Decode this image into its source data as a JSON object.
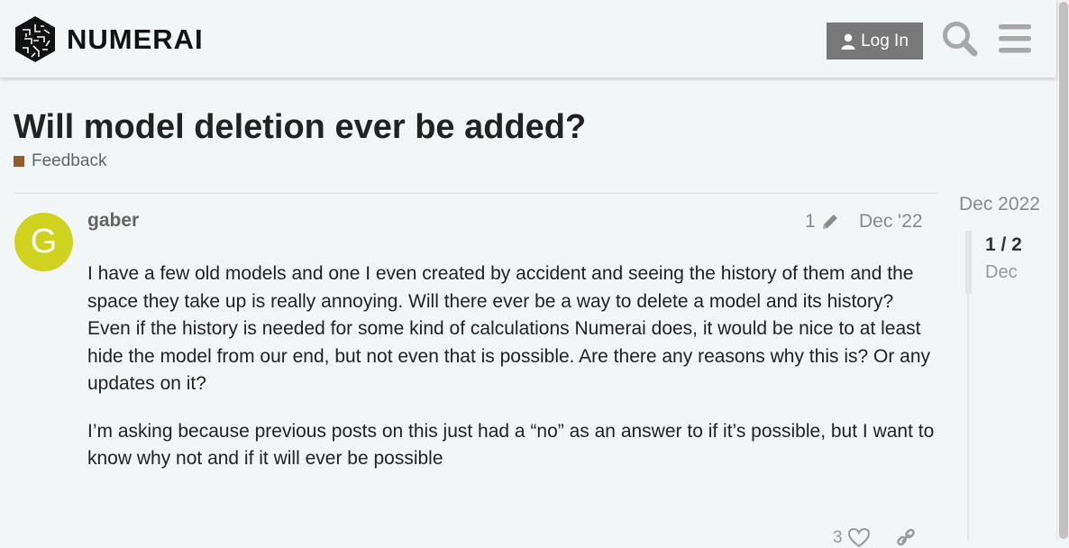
{
  "header": {
    "brand_name": "NUMERAI",
    "login_label": "Log In",
    "icons": [
      "numerai-logo-icon",
      "user-icon",
      "search-icon",
      "hamburger-menu-icon"
    ]
  },
  "topic": {
    "title": "Will model deletion ever be added?",
    "category": "Feedback",
    "category_color": "#8e5e2e"
  },
  "post": {
    "avatar_letter": "G",
    "avatar_color": "#cfd21e",
    "username": "gaber",
    "edit_count": "1",
    "date": "Dec '22",
    "paragraphs": [
      "I have a few old models and one I even created by accident and seeing the history of them and the space they take up is really annoying. Will there ever be a way to delete a model and its history? Even if the history is needed for some kind of calculations Numerai does, it would be nice to at least hide the model from our end, but not even that is possible. Are there any reasons why this is? Or any updates on it?",
      "I’m asking because previous posts on this just had a “no” as an answer to if it’s possible, but I want to know why not and if it will ever be possible"
    ],
    "like_count": "3"
  },
  "timeline": {
    "start_date": "Dec 2022",
    "position": "1 / 2",
    "position_date": "Dec"
  }
}
